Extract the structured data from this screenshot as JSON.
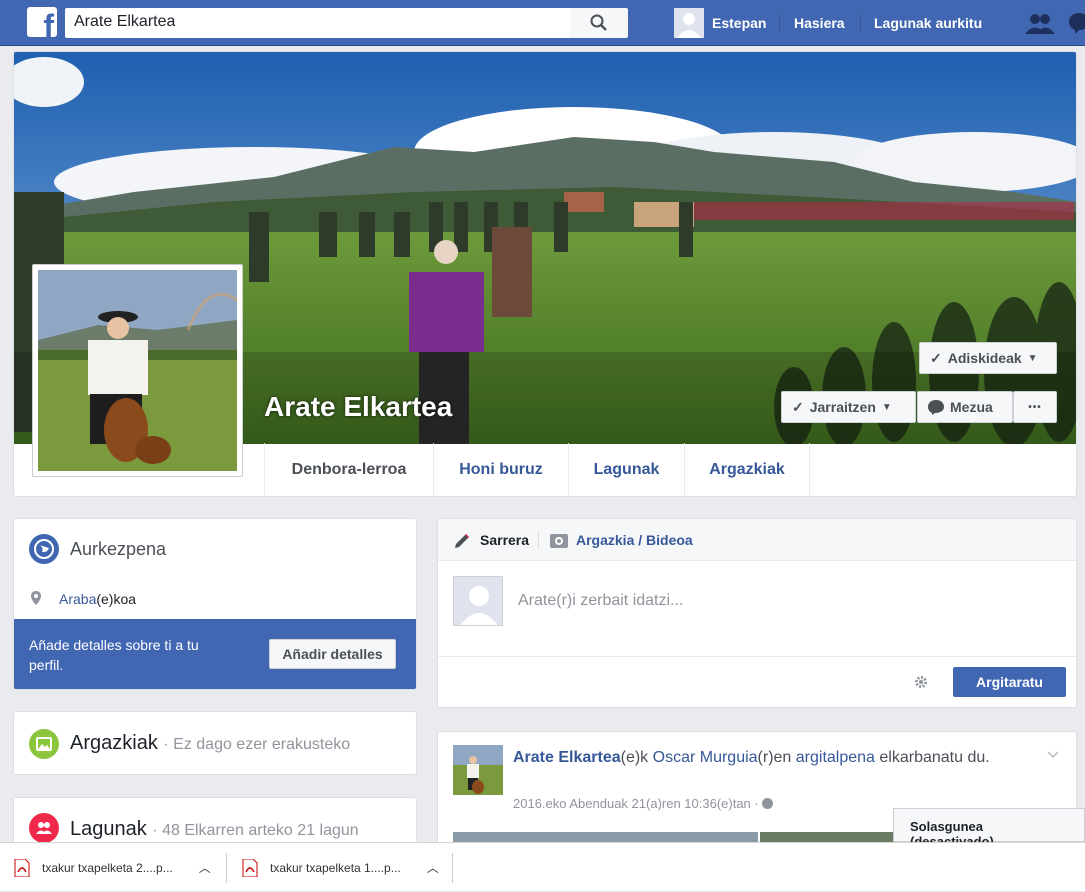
{
  "topbar": {
    "logo": "f",
    "search_value": "Arate Elkartea",
    "user_name": "Estepan",
    "home_label": "Hasiera",
    "find_friends_label": "Lagunak aurkitu"
  },
  "profile": {
    "name": "Arate Elkartea",
    "friends_button": "Adiskideak",
    "following_button": "Jarraitzen",
    "message_button": "Mezua",
    "more_button": "•••"
  },
  "tabs": [
    {
      "label": "Denbora-lerroa"
    },
    {
      "label": "Honi buruz"
    },
    {
      "label": "Lagunak"
    },
    {
      "label": "Argazkiak"
    }
  ],
  "intro": {
    "title": "Aurkezpena",
    "location_link": "Araba",
    "location_suffix": "(e)koa",
    "banner_text": "Añade detalles sobre ti a tu perfil.",
    "banner_button": "Añadir detalles"
  },
  "photos": {
    "title": "Argazkiak",
    "subtitle": "· Ez dago ezer erakusteko"
  },
  "friends": {
    "title": "Lagunak",
    "subtitle": "· 48 Elkarren arteko 21 lagun"
  },
  "composer": {
    "tab_post": "Sarrera",
    "tab_photo": "Argazkia / Bideoa",
    "placeholder": "Arate(r)i zerbait idatzi...",
    "publish_button": "Argitaratu"
  },
  "post": {
    "author": "Arate Elkartea",
    "text1": "(e)k ",
    "person": "Oscar Murguia",
    "text2": "(r)en ",
    "post_link": "argitalpena",
    "text3": " elkarbanatu du.",
    "timestamp": "2016.eko Abenduak 21(a)ren 10:36(e)tan ·"
  },
  "chat": {
    "label": "Solasgunea (desactivado)"
  },
  "downloads": [
    {
      "name": "txakur txapelketa 2....p..."
    },
    {
      "name": "txakur txapelketa 1....p..."
    }
  ],
  "colors": {
    "brand": "#4267b2",
    "link": "#365899",
    "background": "#e9ebee"
  }
}
